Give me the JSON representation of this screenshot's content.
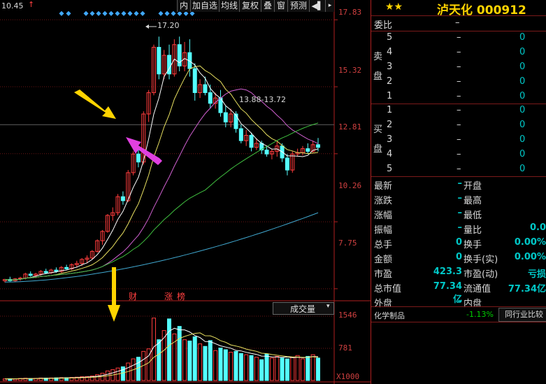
{
  "toolbar": {
    "top_left_price": "10.45",
    "buttons": [
      "内",
      "加自选",
      "均线",
      "复权",
      "叠",
      "窗",
      "预测"
    ],
    "audio_icon": "speaker-icon"
  },
  "price_axis": {
    "labels": [
      "17.83",
      "15.32",
      "12.81",
      "10.26",
      "7.75"
    ]
  },
  "volume_axis": {
    "labels": [
      "1546",
      "781",
      "X1000"
    ]
  },
  "annotations": {
    "peak": "17.20",
    "range": "13.88-13.72",
    "markers": [
      "财",
      "涨",
      "榜"
    ],
    "volume_selector": "成交量"
  },
  "chart_data": {
    "type": "candlestick",
    "ylim": [
      7.3,
      18.1
    ],
    "price_ticks": [
      17.83,
      15.32,
      12.81,
      10.26,
      7.75
    ],
    "candles": [
      [
        8.05,
        8.12,
        7.98,
        8.1
      ],
      [
        8.1,
        8.2,
        8.02,
        8.05
      ],
      [
        8.05,
        8.15,
        8.0,
        8.12
      ],
      [
        8.12,
        8.2,
        8.05,
        8.15
      ],
      [
        8.15,
        8.35,
        8.1,
        8.3
      ],
      [
        8.3,
        8.4,
        8.2,
        8.25
      ],
      [
        8.25,
        8.35,
        8.15,
        8.3
      ],
      [
        8.3,
        8.45,
        8.25,
        8.4
      ],
      [
        8.4,
        8.5,
        8.3,
        8.35
      ],
      [
        8.35,
        8.5,
        8.3,
        8.45
      ],
      [
        8.45,
        8.55,
        8.35,
        8.4
      ],
      [
        8.4,
        8.6,
        8.35,
        8.55
      ],
      [
        8.55,
        8.65,
        8.45,
        8.5
      ],
      [
        8.5,
        8.7,
        8.45,
        8.65
      ],
      [
        8.65,
        8.8,
        8.55,
        8.7
      ],
      [
        8.7,
        8.9,
        8.6,
        8.85
      ],
      [
        8.85,
        9.0,
        8.7,
        8.9
      ],
      [
        8.9,
        9.2,
        8.85,
        9.15
      ],
      [
        9.15,
        9.6,
        9.1,
        9.55
      ],
      [
        9.55,
        9.95,
        9.4,
        9.9
      ],
      [
        9.9,
        10.55,
        9.85,
        10.5
      ],
      [
        10.5,
        10.8,
        10.3,
        10.6
      ],
      [
        10.6,
        11.3,
        10.5,
        11.2
      ],
      [
        11.2,
        11.4,
        10.9,
        11.05
      ],
      [
        11.05,
        12.2,
        11.0,
        12.1
      ],
      [
        12.1,
        12.9,
        12.0,
        12.8
      ],
      [
        12.8,
        13.1,
        12.3,
        12.5
      ],
      [
        12.5,
        14.4,
        12.4,
        14.3
      ],
      [
        14.3,
        15.2,
        14.0,
        15.1
      ],
      [
        15.1,
        16.9,
        15.0,
        16.8
      ],
      [
        16.8,
        17.2,
        15.6,
        15.8
      ],
      [
        15.8,
        16.7,
        15.6,
        16.5
      ],
      [
        16.5,
        16.9,
        15.6,
        15.8
      ],
      [
        15.8,
        17.1,
        15.7,
        16.9
      ],
      [
        16.9,
        17.2,
        15.9,
        16.1
      ],
      [
        16.1,
        17.0,
        15.9,
        16.6
      ],
      [
        16.6,
        17.1,
        15.7,
        16.0
      ],
      [
        16.0,
        16.2,
        14.8,
        15.1
      ],
      [
        15.1,
        15.6,
        14.9,
        15.4
      ],
      [
        15.4,
        15.7,
        15.0,
        15.1
      ],
      [
        15.1,
        15.4,
        14.5,
        14.7
      ],
      [
        14.7,
        15.1,
        14.5,
        14.9
      ],
      [
        14.9,
        15.2,
        14.2,
        14.35
      ],
      [
        14.35,
        14.6,
        13.8,
        14.0
      ],
      [
        14.0,
        14.5,
        13.8,
        14.3
      ],
      [
        14.3,
        14.4,
        13.6,
        13.75
      ],
      [
        13.75,
        13.9,
        13.2,
        13.3
      ],
      [
        13.3,
        13.7,
        13.1,
        13.5
      ],
      [
        13.5,
        13.6,
        12.9,
        13.05
      ],
      [
        13.05,
        13.4,
        12.95,
        13.2
      ],
      [
        13.2,
        13.3,
        12.8,
        12.95
      ],
      [
        12.95,
        13.1,
        12.7,
        12.8
      ],
      [
        12.8,
        13.0,
        12.6,
        12.9
      ],
      [
        12.9,
        13.3,
        12.7,
        13.1
      ],
      [
        13.1,
        13.2,
        12.5,
        12.65
      ],
      [
        12.65,
        12.8,
        12.0,
        12.2
      ],
      [
        12.2,
        12.9,
        12.1,
        12.8
      ],
      [
        12.8,
        13.0,
        12.7,
        12.85
      ],
      [
        12.85,
        13.1,
        12.75,
        13.0
      ],
      [
        13.0,
        13.2,
        12.8,
        12.9
      ],
      [
        12.9,
        13.3,
        12.85,
        13.15
      ],
      [
        13.15,
        13.4,
        12.9,
        13.05
      ]
    ],
    "volumes": [
      40,
      45,
      38,
      50,
      55,
      48,
      52,
      60,
      58,
      62,
      65,
      70,
      68,
      75,
      80,
      90,
      95,
      110,
      140,
      175,
      230,
      260,
      300,
      330,
      420,
      520,
      560,
      700,
      760,
      1500,
      980,
      1200,
      1480,
      1120,
      1300,
      980,
      950,
      1050,
      880,
      820,
      960,
      720,
      780,
      740,
      680,
      700,
      650,
      620,
      600,
      560,
      500,
      640,
      540,
      580,
      540,
      520,
      560,
      600,
      520,
      580,
      620,
      540
    ],
    "ma_series": [
      {
        "color": "#ffffff"
      },
      {
        "color": "#e8e060"
      },
      {
        "color": "#d060d0"
      },
      {
        "color": "#40c040"
      },
      {
        "color": "#40a8d0"
      }
    ]
  },
  "quote": {
    "stars": "★★",
    "title": "泸天化 000912",
    "weibi_label": "委比",
    "weibi_value": "–",
    "sell_label": "卖\n盘",
    "buy_label": "买\n盘",
    "sell_rows": [
      [
        "5",
        "–",
        "0"
      ],
      [
        "4",
        "–",
        "0"
      ],
      [
        "3",
        "–",
        "0"
      ],
      [
        "2",
        "–",
        "0"
      ],
      [
        "1",
        "–",
        "0"
      ]
    ],
    "buy_rows": [
      [
        "1",
        "–",
        "0"
      ],
      [
        "2",
        "–",
        "0"
      ],
      [
        "3",
        "–",
        "0"
      ],
      [
        "4",
        "–",
        "0"
      ],
      [
        "5",
        "–",
        "0"
      ]
    ],
    "stats": [
      [
        "最新",
        "–",
        "开盘",
        ""
      ],
      [
        "涨跌",
        "–",
        "最高",
        ""
      ],
      [
        "涨幅",
        "–",
        "最低",
        ""
      ],
      [
        "振幅",
        "–",
        "量比",
        "0.0"
      ],
      [
        "总手",
        "0",
        "换手",
        "0.00%"
      ],
      [
        "金额",
        "0",
        "换手(实)",
        "0.00%"
      ],
      [
        "市盈",
        "423.3",
        "市盈(动)",
        "亏损"
      ],
      [
        "总市值",
        "77.34亿",
        "流通值",
        "77.34亿"
      ],
      [
        "外盘",
        "–",
        "内盘",
        ""
      ]
    ],
    "industry_name": "化学制品",
    "industry_change": "-1.13%",
    "industry_compare": "同行业比较"
  },
  "colors": {
    "up": "#ff3c3c",
    "down": "#54ffff",
    "bg": "#000000",
    "grid": "#7a1a1a",
    "quote_value": "#00c8c8",
    "title": "#ffd400"
  }
}
